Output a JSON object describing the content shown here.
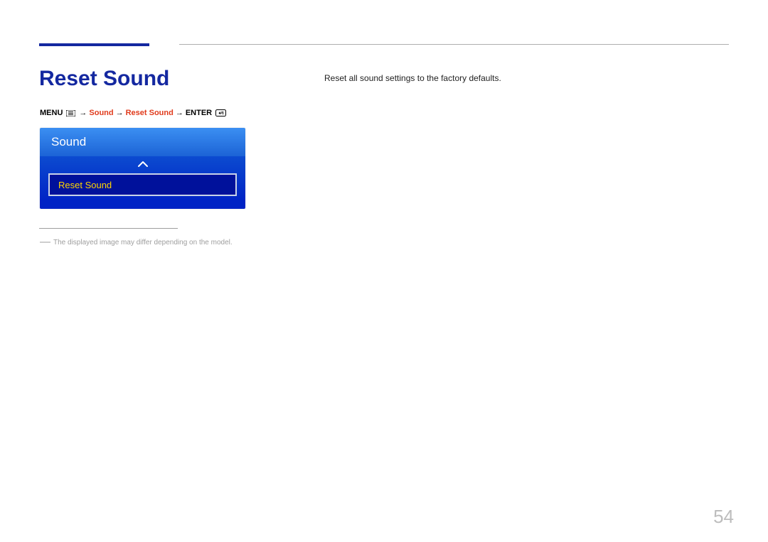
{
  "heading": "Reset Sound",
  "breadcrumb": {
    "menu_label": "MENU",
    "arrow": "→",
    "segment1": "Sound",
    "segment2": "Reset Sound",
    "enter_label": "ENTER"
  },
  "osd": {
    "title": "Sound",
    "item_label": "Reset Sound"
  },
  "footnote": "The displayed image may differ depending on the model.",
  "body_text": "Reset all sound settings to the factory defaults.",
  "page_number": "54"
}
